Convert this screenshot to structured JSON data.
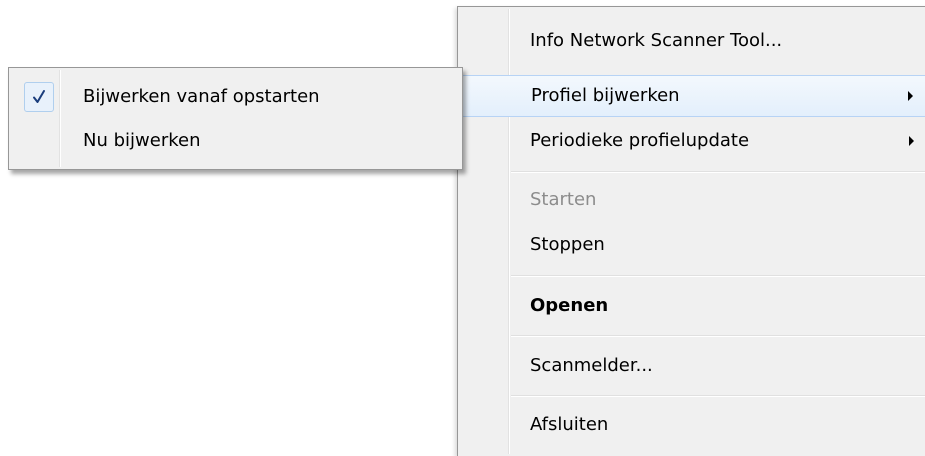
{
  "main_menu": {
    "info": "Info Network Scanner Tool...",
    "profile_update": "Profiel bijwerken",
    "periodic_update": "Periodieke profielupdate",
    "start": "Starten",
    "stop": "Stoppen",
    "open": "Openen",
    "scan_reporter": "Scanmelder...",
    "exit": "Afsluiten"
  },
  "sub_menu": {
    "update_on_startup": "Bijwerken vanaf opstarten",
    "update_on_startup_checked": true,
    "update_now": "Nu bijwerken"
  },
  "icons": {
    "submenu_arrow": "chevron-right-icon",
    "check": "checkmark-icon"
  },
  "colors": {
    "menu_background": "#f0f0f0",
    "menu_border": "#979797",
    "highlight_border": "#b7d3f5",
    "disabled_text": "#8c8c8c",
    "check_color": "#1a3d7c"
  }
}
